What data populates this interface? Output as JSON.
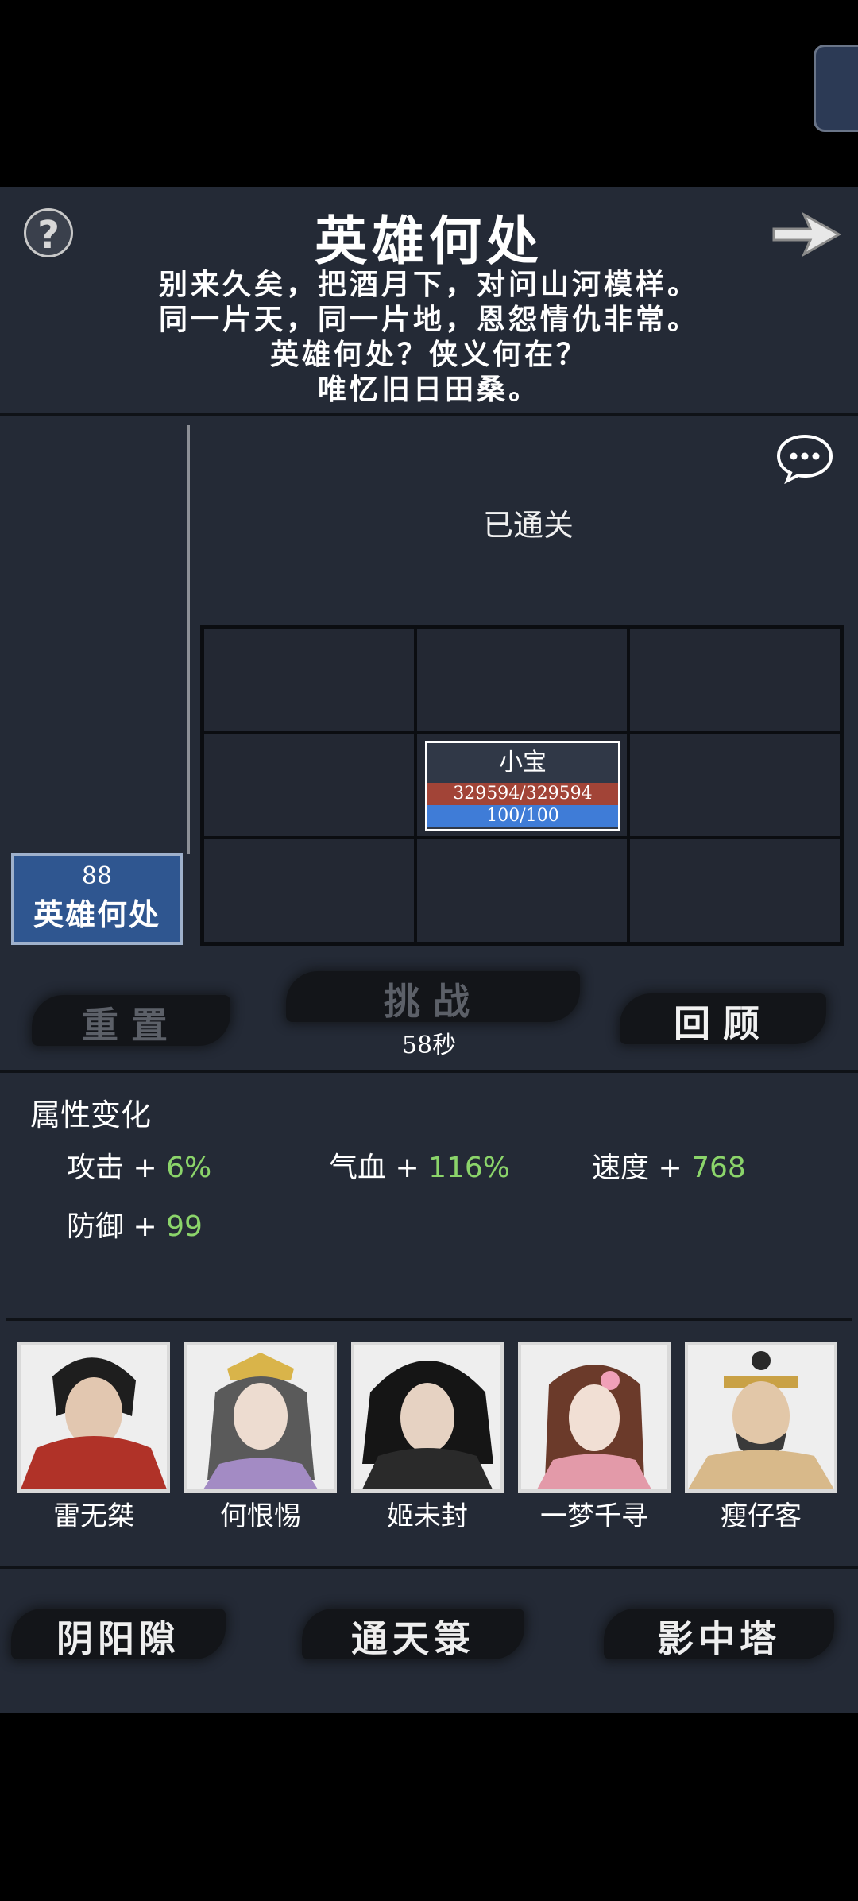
{
  "header": {
    "title": "英雄何处",
    "poem": [
      "别来久矣，把酒月下，对问山河模样。",
      "同一片天，同一片地，恩怨情仇非常。",
      "英雄何处？侠义何在？",
      "唯忆旧日田桑。"
    ],
    "help_label": "?"
  },
  "stage": {
    "status": "已通关",
    "number": "88",
    "name": "英雄何处"
  },
  "battle_grid": {
    "unit_name": "小宝",
    "hp_text": "329594/329594",
    "mp_text": "100/100",
    "hp_fraction": 1.0,
    "mp_fraction": 1.0
  },
  "actions": {
    "reset_label": "重置",
    "challenge_label": "挑战",
    "review_label": "回顾",
    "timer": "58秒"
  },
  "attributes": {
    "title": "属性变化",
    "items": [
      {
        "name": "攻击 + ",
        "value": "6%"
      },
      {
        "name": "气血 + ",
        "value": "116%"
      },
      {
        "name": "速度 + ",
        "value": "768"
      },
      {
        "name": "防御 + ",
        "value": "99"
      }
    ],
    "value_color": "#8bd46a"
  },
  "heroes": [
    {
      "name": "雷无桀"
    },
    {
      "name": "何恨惕"
    },
    {
      "name": "姬未封"
    },
    {
      "name": "一梦千寻"
    },
    {
      "name": "瘦仔客"
    }
  ],
  "bottom_nav": [
    {
      "label": "阴阳隙"
    },
    {
      "label": "通天箓"
    },
    {
      "label": "影中塔"
    }
  ],
  "colors": {
    "panel_bg": "#242a36",
    "hp_bar": "#a24437",
    "mp_bar": "#3f7cd7",
    "stage_card": "#2f5690"
  }
}
